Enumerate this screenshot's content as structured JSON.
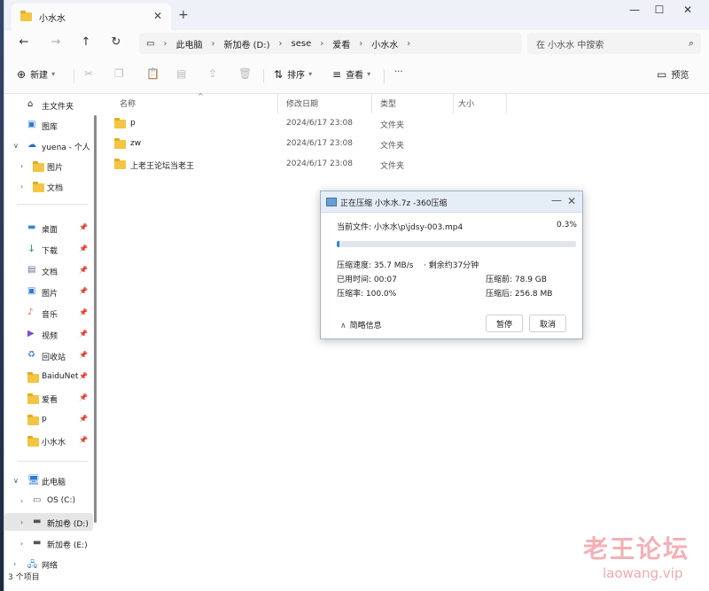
{
  "window": {
    "tab_title": "小水水",
    "new_tab": "+"
  },
  "nav": {
    "breadcrumbs": [
      "此电脑",
      "新加卷 (D:)",
      "sese",
      "爱看",
      "小水水"
    ],
    "search_placeholder": "在 小水水 中搜索"
  },
  "toolbar": {
    "new_label": "新建",
    "sort_label": "排序",
    "view_label": "查看",
    "more_label": "···",
    "preview_label": "预览"
  },
  "sidebar": {
    "items": [
      {
        "label": "主文件夹",
        "icon": "home-icon"
      },
      {
        "label": "图库",
        "icon": "gallery-icon"
      },
      {
        "label": "yuena - 个人",
        "icon": "cloud-icon"
      },
      {
        "label": "图片",
        "icon": "folder-icon"
      },
      {
        "label": "文档",
        "icon": "folder-icon"
      },
      {
        "label": "桌面",
        "icon": "desktop-icon"
      },
      {
        "label": "下载",
        "icon": "download-icon"
      },
      {
        "label": "文档",
        "icon": "document-icon"
      },
      {
        "label": "图片",
        "icon": "picture-icon"
      },
      {
        "label": "音乐",
        "icon": "music-icon"
      },
      {
        "label": "视频",
        "icon": "video-icon"
      },
      {
        "label": "回收站",
        "icon": "recycle-icon"
      },
      {
        "label": "BaiduNet",
        "icon": "folder-icon"
      },
      {
        "label": "爱看",
        "icon": "folder-icon"
      },
      {
        "label": "p",
        "icon": "folder-icon"
      },
      {
        "label": "小水水",
        "icon": "folder-icon"
      },
      {
        "label": "此电脑",
        "icon": "computer-icon"
      },
      {
        "label": "OS (C:)",
        "icon": "drive-icon"
      },
      {
        "label": "新加卷 (D:)",
        "icon": "drive-icon"
      },
      {
        "label": "新加卷 (E:)",
        "icon": "drive-icon"
      },
      {
        "label": "网络",
        "icon": "network-icon"
      }
    ]
  },
  "columns": {
    "name": "名称",
    "date": "修改日期",
    "type": "类型",
    "size": "大小"
  },
  "files": [
    {
      "name": "p",
      "date": "2024/6/17 23:08",
      "type": "文件夹"
    },
    {
      "name": "zw",
      "date": "2024/6/17 23:08",
      "type": "文件夹"
    },
    {
      "name": "上老王论坛当老王",
      "date": "2024/6/17 23:08",
      "type": "文件夹"
    }
  ],
  "status": {
    "count": "3 个项目"
  },
  "dialog": {
    "title": "正在压缩 小水水.7z -360压缩",
    "current_file": "当前文件: 小水水\\p\\jdsy-003.mp4",
    "percent_text": "0.3%",
    "progress": 0.003,
    "speed": "压缩速度: 35.7 MB/s",
    "remaining": "· 剩余约37分钟",
    "elapsed": "已用时间: 00:07",
    "ratio": "压缩率:    100.0%",
    "before": "压缩前: 78.9 GB",
    "after": "压缩后: 256.8 MB",
    "brief": "简略信息",
    "pause": "暂停",
    "cancel": "取消"
  },
  "watermark": {
    "cn": "老王论坛",
    "en": "laowang.vip"
  },
  "colors": {
    "accent": "#2d8ad7",
    "folder": "#f4c542"
  }
}
